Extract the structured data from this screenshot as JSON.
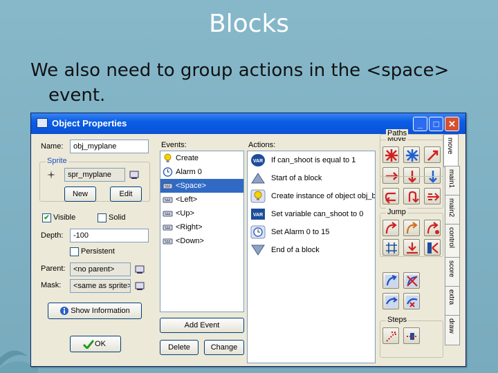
{
  "slide": {
    "title": "Blocks",
    "line1": "We also need to group actions in the <space>",
    "line2": "event."
  },
  "window": {
    "title": "Object Properties",
    "minimize": "_",
    "maximize": "□",
    "close": "✕"
  },
  "props": {
    "name_label": "Name:",
    "name_value": "obj_myplane",
    "sprite_group": "Sprite",
    "sprite_value": "spr_myplane",
    "new_btn": "New",
    "edit_btn": "Edit",
    "visible_label": "Visible",
    "visible_checked": true,
    "solid_label": "Solid",
    "solid_checked": false,
    "depth_label": "Depth:",
    "depth_value": "-100",
    "persistent_label": "Persistent",
    "parent_label": "Parent:",
    "parent_value": "<no parent>",
    "mask_label": "Mask:",
    "mask_value": "<same as sprite>",
    "show_info_btn": "Show Information",
    "ok_btn": "OK"
  },
  "events": {
    "header": "Events:",
    "items": [
      {
        "label": "Create",
        "icon": "bulb-icon",
        "selected": false
      },
      {
        "label": "Alarm 0",
        "icon": "clock-icon",
        "selected": false
      },
      {
        "label": "<Space>",
        "icon": "keyboard-icon",
        "selected": true
      },
      {
        "label": "<Left>",
        "icon": "keyboard-icon",
        "selected": false
      },
      {
        "label": "<Up>",
        "icon": "keyboard-icon",
        "selected": false
      },
      {
        "label": "<Right>",
        "icon": "keyboard-icon",
        "selected": false
      },
      {
        "label": "<Down>",
        "icon": "keyboard-icon",
        "selected": false
      }
    ],
    "add_btn": "Add Event",
    "delete_btn": "Delete",
    "change_btn": "Change"
  },
  "actions": {
    "header": "Actions:",
    "items": [
      {
        "label": "If can_shoot is equal to 1",
        "icon": "var-test-icon"
      },
      {
        "label": "Start of a block",
        "icon": "triangle-up-icon"
      },
      {
        "label": "Create instance of object obj_b",
        "icon": "bulb-icon"
      },
      {
        "label": "Set variable can_shoot to 0",
        "icon": "var-set-icon"
      },
      {
        "label": "Set Alarm 0 to 15",
        "icon": "clock-icon"
      },
      {
        "label": "End of a block",
        "icon": "triangle-down-icon"
      }
    ]
  },
  "palette": {
    "move_label": "Move",
    "jump_label": "Jump",
    "paths_label": "Paths",
    "steps_label": "Steps"
  },
  "tabs": [
    "move",
    "main1",
    "main2",
    "control",
    "score",
    "extra",
    "draw"
  ]
}
